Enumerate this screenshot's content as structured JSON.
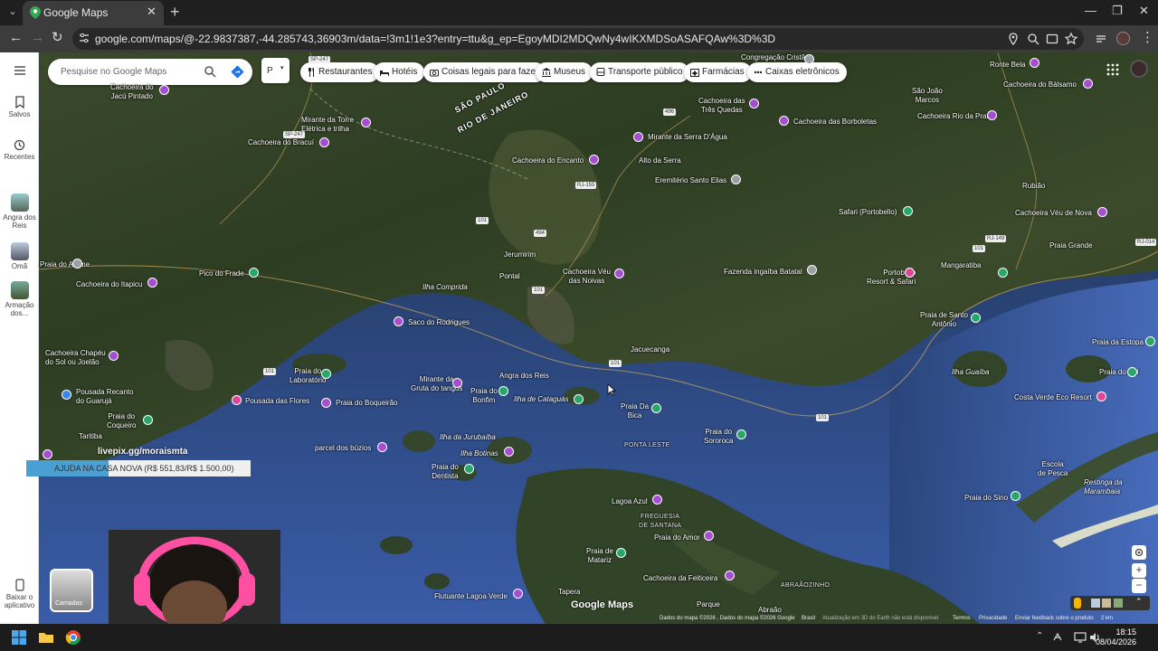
{
  "browser": {
    "tab_title": "Google Maps",
    "url": "google.com/maps/@-22.9837387,-44.285743,36903m/data=!3m1!1e3?entry=ttu&g_ep=EgoyMDI2MDQwNy4wIKXMDSoASAFQAw%3D%3D"
  },
  "search": {
    "placeholder": "Pesquise no Google Maps"
  },
  "sidebar": {
    "saved": "Salvos",
    "recent": "Recentes",
    "recent_places": [
      "Angra dos Reis",
      "Omã",
      "Armação dos..."
    ],
    "get_app": "Baixar o aplicativo"
  },
  "chips": [
    "Restaurantes",
    "Hotéis",
    "Coisas legais para fazer",
    "Museus",
    "Transporte público",
    "Farmácias",
    "Caixas eletrônicos"
  ],
  "places": {
    "jacu_pintado": "Cachoeira do\nJacú Pintado",
    "mirante_torre": "Mirante da Torre\nElétrica e trilha",
    "cachoeira_bracui": "Cachoeira do Bracuí",
    "sao_paulo": "SÃO PAULO",
    "rio_janeiro": "RIO DE JANEIRO",
    "cachoeira_encanto": "Cachoeira do Encanto",
    "mirante_serra": "Mirante da Serra D'Água",
    "alto_serra": "Alto da Serra",
    "eremiterio": "Eremitério Santo Elias",
    "cachoeira_tres_quedas": "Cachoeira das\nTrês Quedas",
    "cachoeira_borboletas": "Cachoeira das Borboletas",
    "congregacao": "Congregação Cristã",
    "ronte_bela": "Ronte Bela",
    "sao_joao_marcos": "São João\nMarcos",
    "cachoeira_balsamo": "Cachoeira do Bálsamo",
    "cachoeira_rio_prata": "Cachoeira Rio da Prata",
    "rubiao": "Rubião",
    "safari_portobello": "Safari (Portobello)",
    "cachoeira_veu_nova": "Cachoeira Véu de Nova",
    "praia_grande": "Praia Grande",
    "jerumirim": "Jerumirim",
    "pontal": "Pontal",
    "cachoeira_veu_noivas": "Cachoeira Véu\ndas Noivas",
    "fazenda_ingaiba": "Fazenda ingaíba Batatal",
    "portobello": "Portobello\nResort & Safari",
    "mangaratiba": "Mangaratiba",
    "pico_frade": "Pico do Frade",
    "praia_arame": "Praia do Arame",
    "cachoeira_itapicu": "Cachoeira do Itapicu",
    "ilha_comprida": "Ilha Comprida",
    "saco_rodrigues": "Saco do Rodrigues",
    "praia_santo_antonio": "Praia de Santo\nAntônio",
    "praia_estopa": "Praia da Estopa",
    "cachoeira_chapeu": "Cachoeira Chapéu\ndo Sol ou Joelão",
    "praia_laboratorio": "Praia do\nLaboratório",
    "mirante_gruta": "Mirante da\nGruta do tangus",
    "angra_reis": "Angra dos Reis",
    "jacuecanga": "Jacuecanga",
    "ilha_guaiba": "Ilha Guaíba",
    "costa_verde": "Costa Verde Eco Resort",
    "praia_sul": "Praia do Sul",
    "pousada_recanto": "Pousada Recanto\ndo Guarujá",
    "pousada_flores": "Pousada das Flores",
    "praia_boqueirao": "Praia do Boqueirão",
    "praia_bonfim": "Praia do\nBonfim",
    "ilha_cataguas": "Ilha de Cataguás",
    "praia_bica": "Praia Da\nBica",
    "praia_sororoca": "Praia do\nSororoca",
    "taritiba": "Taritiba",
    "praia_coqueiro": "Praia do\nCoqueiro",
    "ilha_jurubaiba": "Ilha da Jurubaíba",
    "ilha_botinas": "Ilha Botinas",
    "parcel_buzios": "parcel dos búzios",
    "praia_dentista": "Praia do\nDentista",
    "ponta_leste": "PONTA LESTE",
    "escola_pesca": "Escola\nde Pesca",
    "restinga": "Restinga da\nMarambaia",
    "praia_sino": "Praia do Sino",
    "lagoa_azul": "Lagoa Azul",
    "freguesia": "FREGUESIA\nDE SANTANA",
    "praia_amor": "Praia do Amor",
    "praia_matariz": "Praia de\nMatariz",
    "cachoeira_feiticeira": "Cachoeira da Feiticeira",
    "flutuante": "Flutuante Lagoa Verde",
    "tapera": "Tapera",
    "parque": "Parque",
    "abraao": "Abraão",
    "abraaozinho": "ABRAÃOZINHO"
  },
  "overlays": {
    "livepix": "livepix.gg/moraismta",
    "donation": "AJUDA NA CASA NOVA (R$ 551,83/R$ 1.500,00)",
    "donation_progress": 0.368
  },
  "map": {
    "layers_label": "Camadas",
    "logo": "Google Maps",
    "attribution": "Dados do mapa ©2026 , Dados do mapa ©2026 Google",
    "country": "Brasil",
    "notice": "Atualização em 3D do Earth não está disponível",
    "terms": "Termos",
    "privacy": "Privacidade",
    "feedback": "Enviar feedback sobre o produto",
    "scale": "2 km"
  },
  "taskbar": {
    "time": "18:15",
    "date": "08/04/2026"
  },
  "colors": {
    "ocean": "#2e4a8c",
    "land": "#34452a",
    "pin_purple": "#a64dd1",
    "pin_green": "#27a86a"
  }
}
